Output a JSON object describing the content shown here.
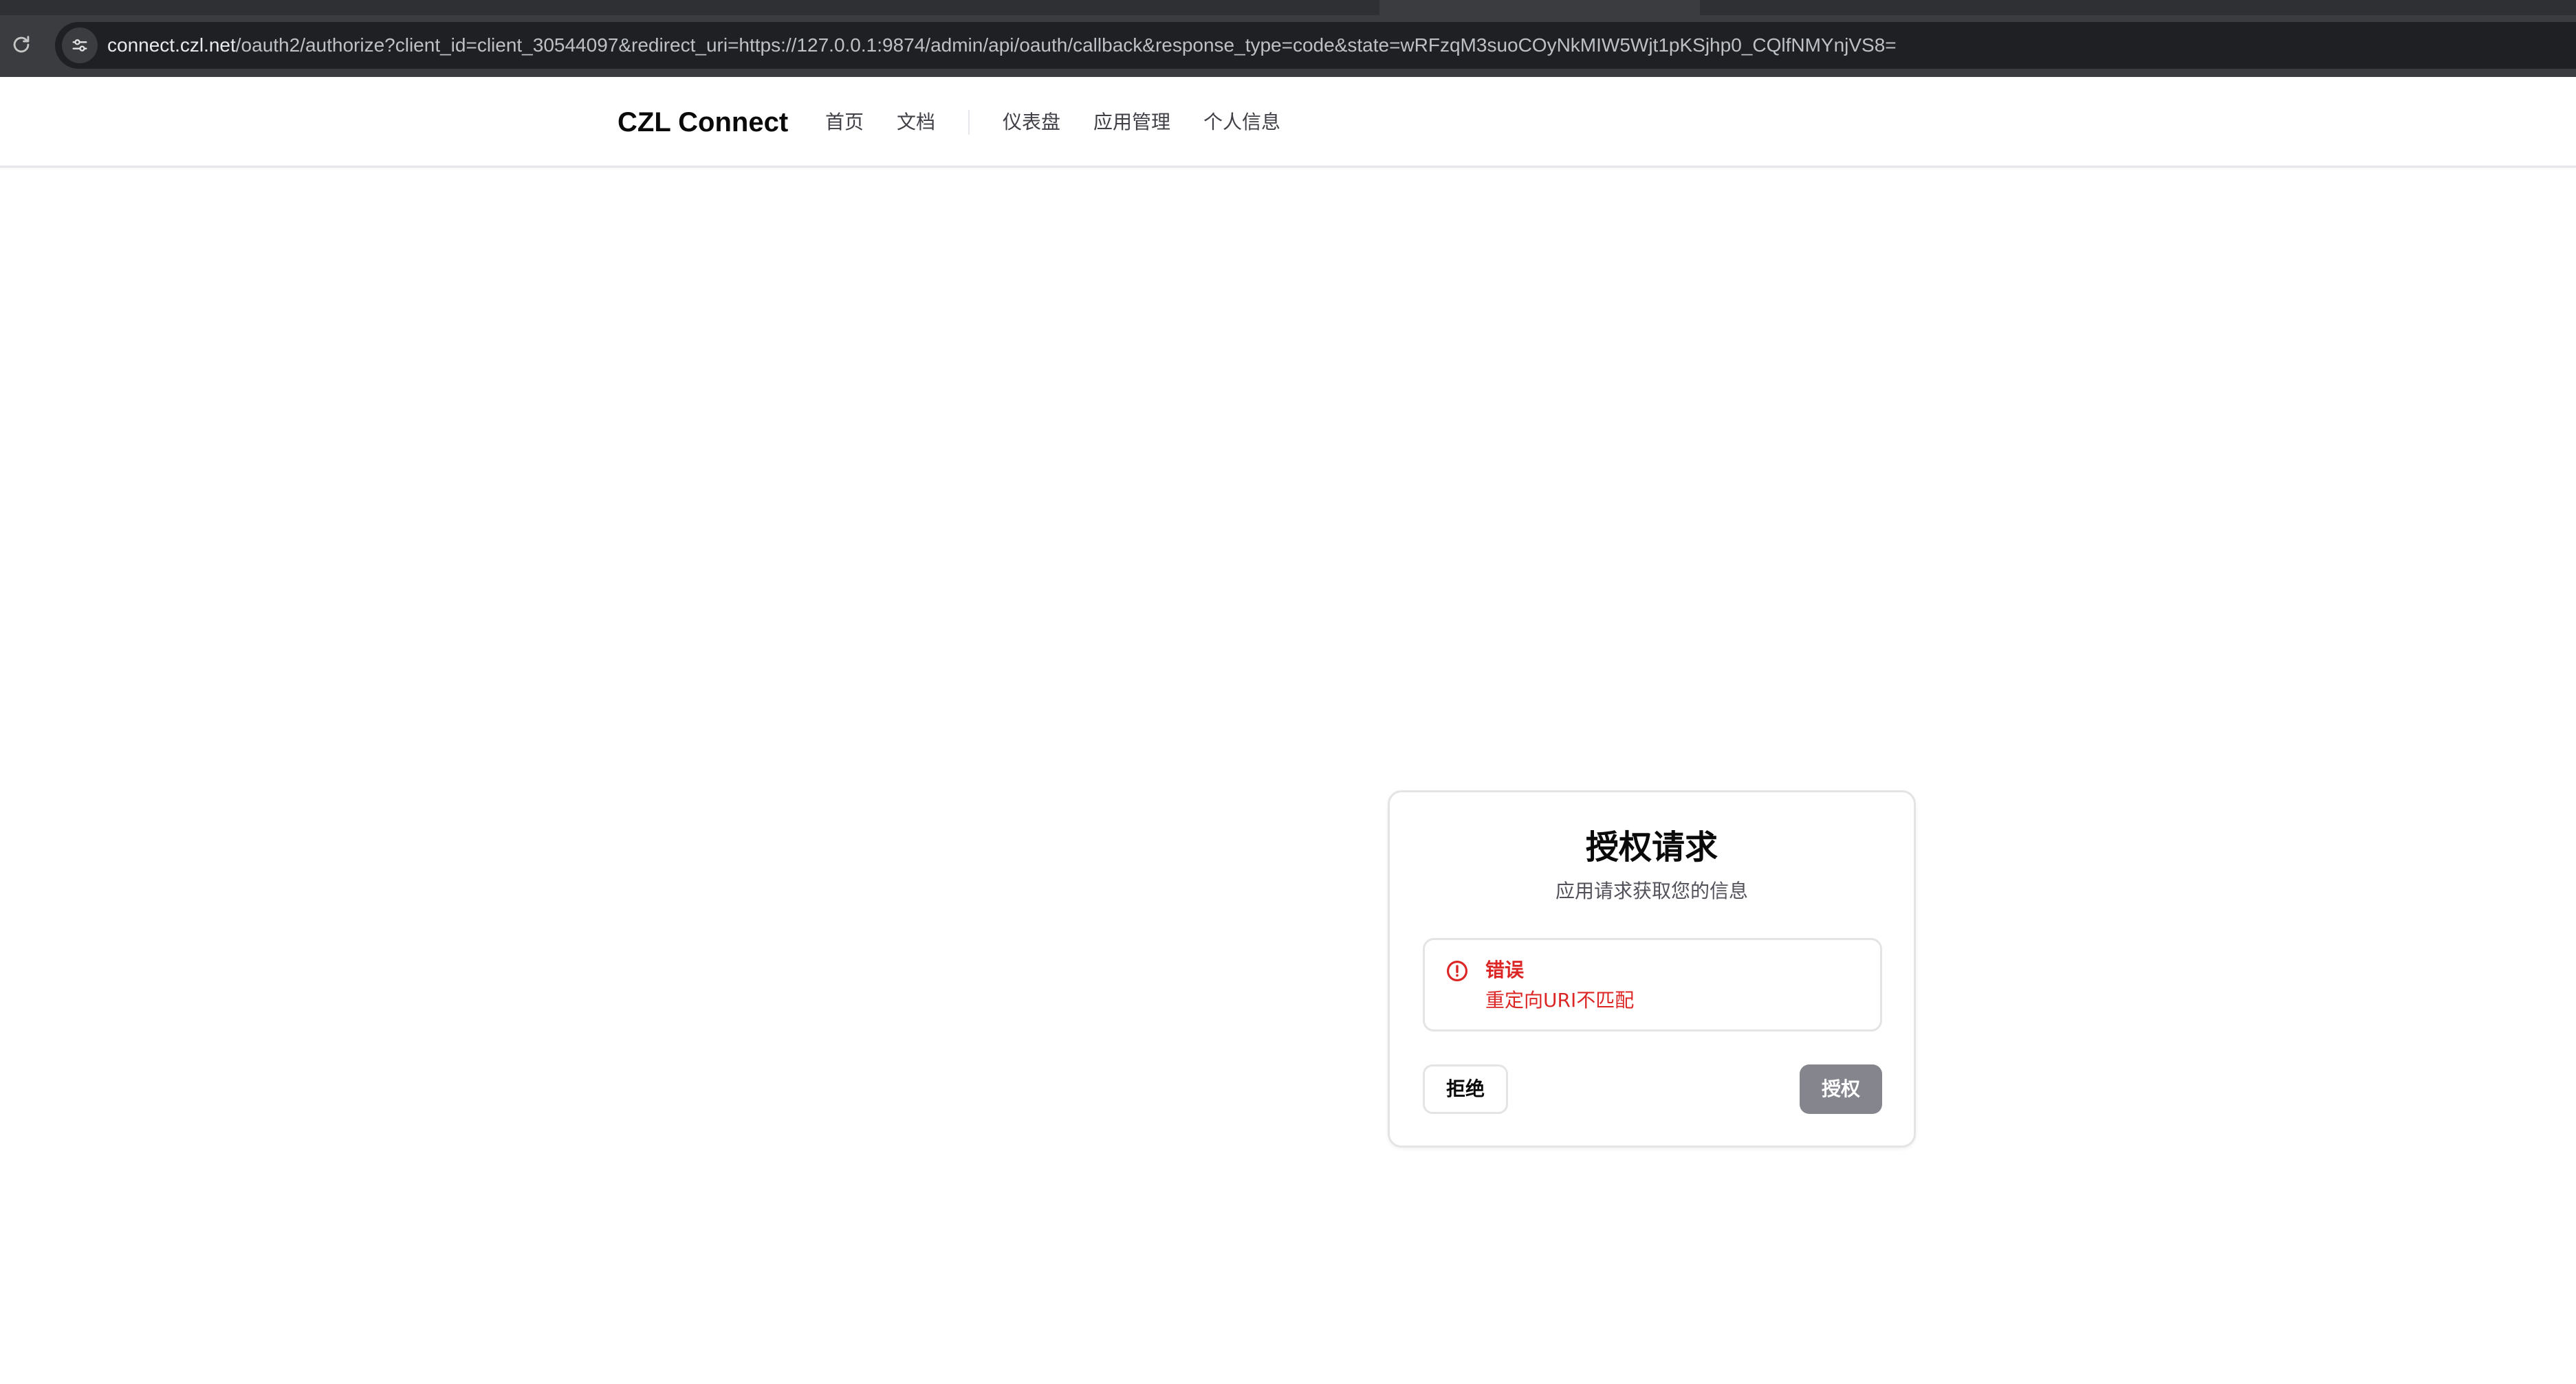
{
  "browser": {
    "url_host": "connect.czl.net",
    "url_path": "/oauth2/authorize?client_id=client_30544097&redirect_uri=https://127.0.0.1:9874/admin/api/oauth/callback&response_type=code&state=wRFzqM3suoCOyNkMIW5Wjt1pKSjhp0_CQlfNMYnjVS8="
  },
  "navbar": {
    "brand": "CZL Connect",
    "links": [
      {
        "label": "首页"
      },
      {
        "label": "文档"
      },
      {
        "label": "仪表盘"
      },
      {
        "label": "应用管理"
      },
      {
        "label": "个人信息"
      }
    ]
  },
  "auth_card": {
    "title": "授权请求",
    "subtitle": "应用请求获取您的信息",
    "alert": {
      "title": "错误",
      "message": "重定向URI不匹配"
    },
    "deny_label": "拒绝",
    "authorize_label": "授权",
    "authorize_disabled": true
  },
  "colors": {
    "error": "#dc2626",
    "authorize_disabled_bg": "#85858d",
    "chrome_bg": "#3b3c3f"
  },
  "icons": {
    "reload": "reload-icon",
    "site_info": "tune-icon",
    "alert": "alert-circle-icon"
  }
}
